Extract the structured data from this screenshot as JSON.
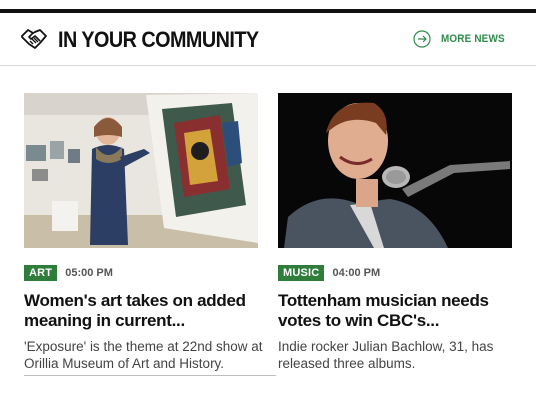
{
  "header": {
    "title": "IN YOUR COMMUNITY",
    "more_label": "MORE NEWS",
    "accent": "#2e8b4a",
    "icon": "handshake-icon",
    "more_icon": "arrow-right-circle-icon"
  },
  "cards": [
    {
      "category": "ART",
      "time": "05:00 PM",
      "headline": "Women's art takes on added meaning in current...",
      "summary": "'Exposure' is the theme at 22nd show at Orillia Museum of Art and History.",
      "image": "woman-with-painting-photo"
    },
    {
      "category": "MUSIC",
      "time": "04:00 PM",
      "headline": "Tottenham musician needs votes to win CBC's...",
      "summary": "Indie rocker Julian Bachlow, 31, has released three albums.",
      "image": "musician-singing-photo"
    }
  ],
  "tag_color": "#2e7d3a"
}
